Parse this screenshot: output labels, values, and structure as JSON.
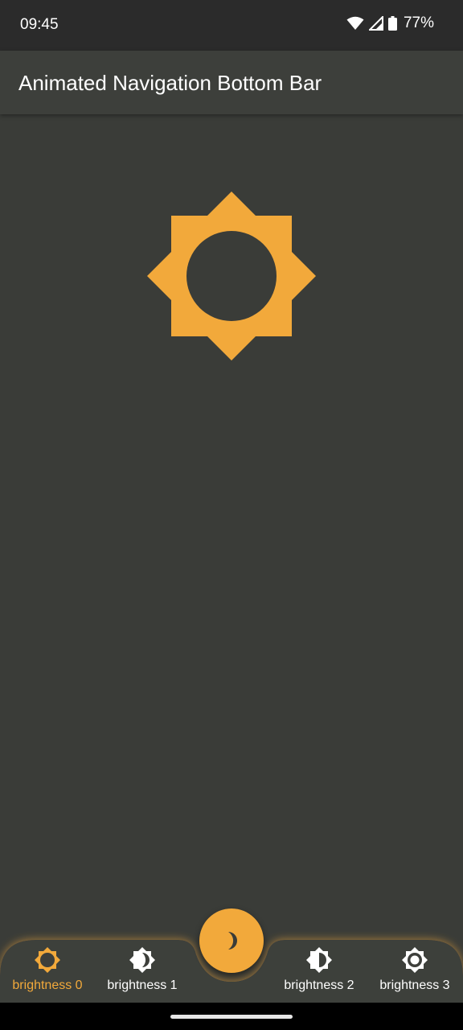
{
  "status_bar": {
    "time": "09:45",
    "battery": "77%",
    "icons": [
      "wifi-icon",
      "signal-icon",
      "battery-icon"
    ]
  },
  "app_bar": {
    "title": "Animated Navigation Bottom Bar"
  },
  "main": {
    "icon": "brightness-high-icon",
    "icon_color": "#f2a93b"
  },
  "bottom_nav": {
    "accent": "#f2a93b",
    "items": [
      {
        "label": "brightness 0",
        "icon": "brightness-low-icon",
        "active": true
      },
      {
        "label": "brightness 1",
        "icon": "brightness-medium-icon",
        "active": false
      },
      {
        "label": "brightness 2",
        "icon": "brightness-half-icon",
        "active": false
      },
      {
        "label": "brightness 3",
        "icon": "brightness-auto-icon",
        "active": false
      }
    ],
    "fab_icon": "moon-icon"
  }
}
